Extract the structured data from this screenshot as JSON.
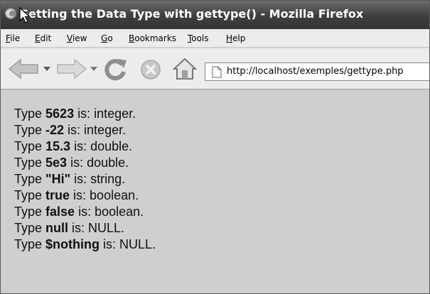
{
  "window": {
    "title": "Getting the Data Type with gettype() - Mozilla Firefox"
  },
  "menu": {
    "items": [
      {
        "underline": "F",
        "rest": "ile"
      },
      {
        "underline": "E",
        "rest": "dit"
      },
      {
        "underline": "V",
        "rest": "iew"
      },
      {
        "underline": "G",
        "rest": "o"
      },
      {
        "underline": "B",
        "rest": "ookmarks"
      },
      {
        "underline": "T",
        "rest": "ools"
      },
      {
        "underline": "H",
        "rest": "elp"
      }
    ]
  },
  "toolbar": {
    "icons": [
      "back-arrow-icon",
      "dropdown-arrow-icon",
      "forward-arrow-icon",
      "dropdown-arrow-icon",
      "reload-icon",
      "stop-icon",
      "home-icon"
    ]
  },
  "address_bar": {
    "url": "http://localhost/exemples/gettype.php"
  },
  "page": {
    "lines": [
      {
        "prefix": "Type ",
        "value": "5623",
        "suffix": " is: integer."
      },
      {
        "prefix": "Type ",
        "value": "-22",
        "suffix": " is: integer."
      },
      {
        "prefix": "Type ",
        "value": "15.3",
        "suffix": " is: double."
      },
      {
        "prefix": "Type ",
        "value": "5e3",
        "suffix": " is: double."
      },
      {
        "prefix": "Type ",
        "value": "\"Hi\"",
        "suffix": " is: string."
      },
      {
        "prefix": "Type ",
        "value": "true",
        "suffix": " is: boolean."
      },
      {
        "prefix": "Type ",
        "value": "false",
        "suffix": " is: boolean."
      },
      {
        "prefix": "Type ",
        "value": "null",
        "suffix": " is: NULL."
      },
      {
        "prefix": "Type ",
        "value": "$nothing",
        "suffix": " is: NULL."
      }
    ]
  }
}
